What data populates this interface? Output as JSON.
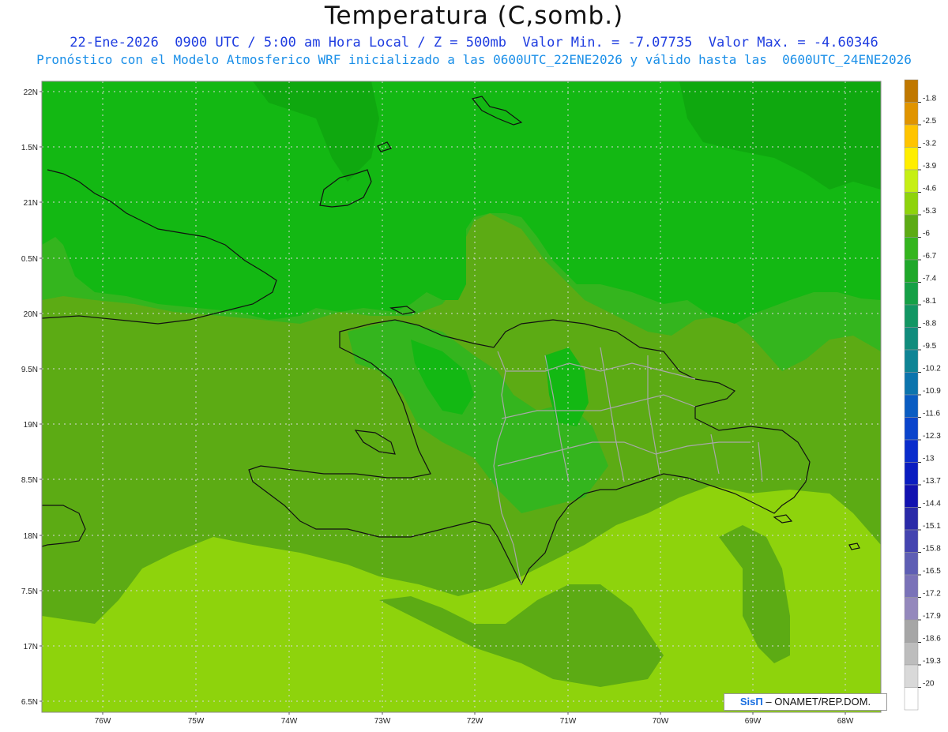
{
  "title": "Temperatura (C,somb.)",
  "subtitle_line1": "22-Ene-2026  0900 UTC / 5:00 am Hora Local / Z = 500mb  Valor Min. = -7.07735  Valor Max. = -4.60346",
  "subtitle_line2": "Pronóstico con el Modelo Atmosferico WRF inicializado a las 0600UTC_22ENE2026 y válido hasta las  0600UTC_24ENE2026",
  "credit": {
    "brand": "SisΠ",
    "text": " – ONAMET/REP.DOM."
  },
  "map": {
    "lat_labels": [
      "22N",
      "1.5N",
      "21N",
      "0.5N",
      "20N",
      "9.5N",
      "19N",
      "8.5N",
      "18N",
      "7.5N",
      "17N",
      "6.5N"
    ],
    "lon_labels": [
      "76W",
      "75W",
      "74W",
      "73W",
      "72W",
      "71W",
      "70W",
      "69W",
      "68W"
    ],
    "colors": {
      "band_-7.4": "#0fa80f",
      "band_-6.7": "#13b813",
      "band_-6.0": "#34b51e",
      "band_-5.3": "#5cab14",
      "band_-4.6": "#8ed30c",
      "border": "#111111",
      "provinces": "#a8a8a8"
    }
  },
  "colorbar": {
    "labels": [
      "-1.8",
      "-2.5",
      "-3.2",
      "-3.9",
      "-4.6",
      "-5.3",
      "-6",
      "-6.7",
      "-7.4",
      "-8.1",
      "-8.8",
      "-9.5",
      "-10.2",
      "-10.9",
      "-11.6",
      "-12.3",
      "-13",
      "-13.7",
      "-14.4",
      "-15.1",
      "-15.8",
      "-16.5",
      "-17.2",
      "-17.9",
      "-18.6",
      "-19.3",
      "-20"
    ],
    "colors": [
      "#c07800",
      "#e09400",
      "#ffc400",
      "#ffee00",
      "#c6ef14",
      "#8ed30c",
      "#5cab14",
      "#34b51e",
      "#1fa82a",
      "#15a046",
      "#129663",
      "#108c7c",
      "#0e8495",
      "#0c74ad",
      "#0a5cc2",
      "#0a44cc",
      "#0a2ccc",
      "#0a1cc0",
      "#1212b0",
      "#2a2aa8",
      "#4444b0",
      "#5e5eb4",
      "#7a72b8",
      "#9488bc",
      "#a6a6a6",
      "#bdbdbd",
      "#d9d9d9",
      "#ffffff"
    ]
  }
}
